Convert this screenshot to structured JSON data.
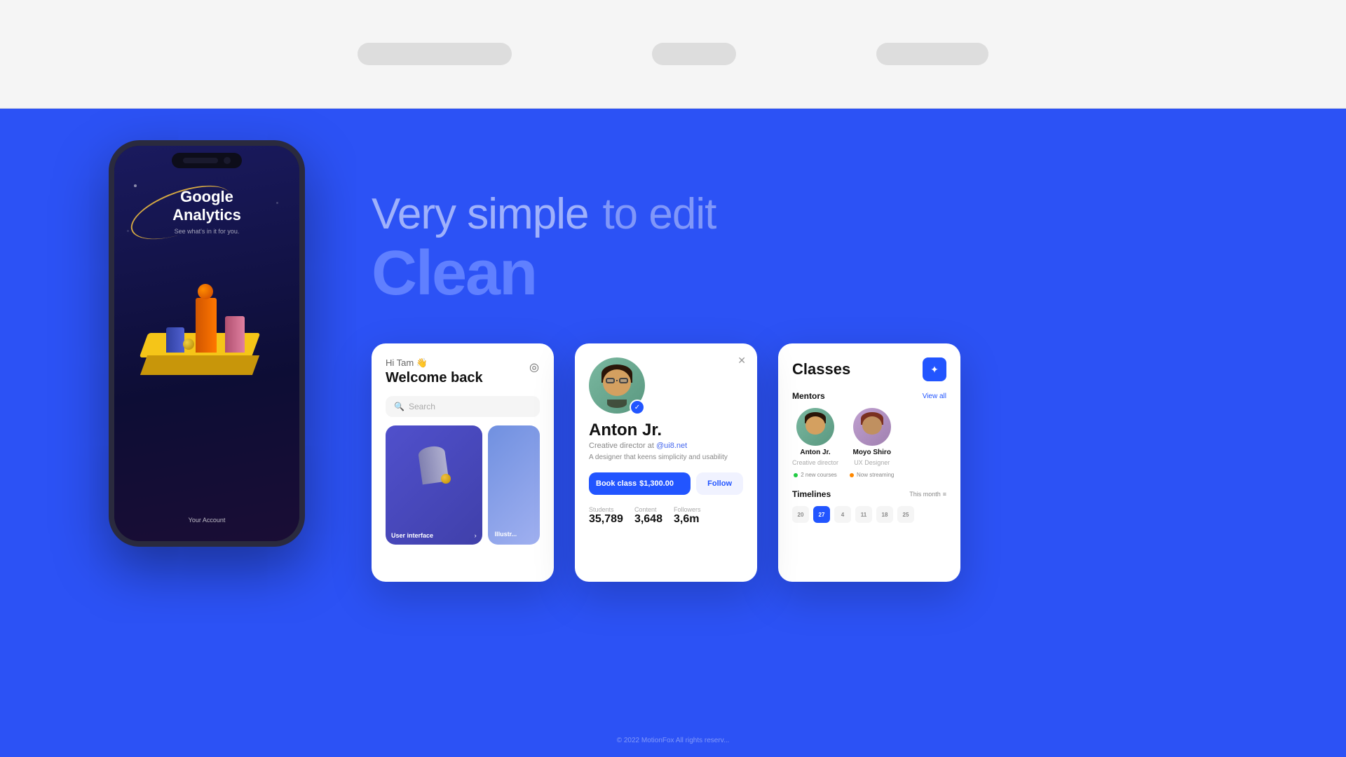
{
  "top": {
    "bg_color": "#f0f0f0"
  },
  "main": {
    "bg_color": "#2c52f5",
    "text_line1a": "Very simple",
    "text_line1b": "to edit",
    "text_line2": "Clean"
  },
  "phone": {
    "title1": "Google",
    "title2": "Analytics",
    "subtitle": "See what's in it for you.",
    "account_label": "Your Account"
  },
  "card_welcome": {
    "greeting": "Hi Tam 👋",
    "title": "Welcome back",
    "search_placeholder": "Search",
    "img1_label": "User interface",
    "img2_label": "Illustr..."
  },
  "card_profile": {
    "name": "Anton Jr.",
    "role_prefix": "Creative director at",
    "role_handle": "@ui8.net",
    "description": "A designer that keens simplicity and usability",
    "btn_book": "Book class",
    "btn_price": "$1,300.00",
    "btn_follow": "Follow",
    "stats": [
      {
        "label": "Students",
        "value": "35,789"
      },
      {
        "label": "Content",
        "value": "3,648"
      },
      {
        "label": "Followers",
        "value": "3,6m"
      }
    ]
  },
  "card_classes": {
    "title": "Classes",
    "mentors_label": "Mentors",
    "view_all": "View all",
    "mentors": [
      {
        "name": "Anton Jr.",
        "role": "Creative director",
        "badge": "2 new courses",
        "badge_color": "green"
      },
      {
        "name": "Moyo Shiro",
        "role": "UX Designer",
        "badge": "Now streaming",
        "badge_color": "orange"
      }
    ],
    "timelines_label": "Timelines",
    "timelines_filter": "This month",
    "calendar_days": [
      "20",
      "27",
      "4",
      "11",
      "18",
      "25"
    ]
  },
  "copyright": "© 2022 MotionFox All rights reserv..."
}
